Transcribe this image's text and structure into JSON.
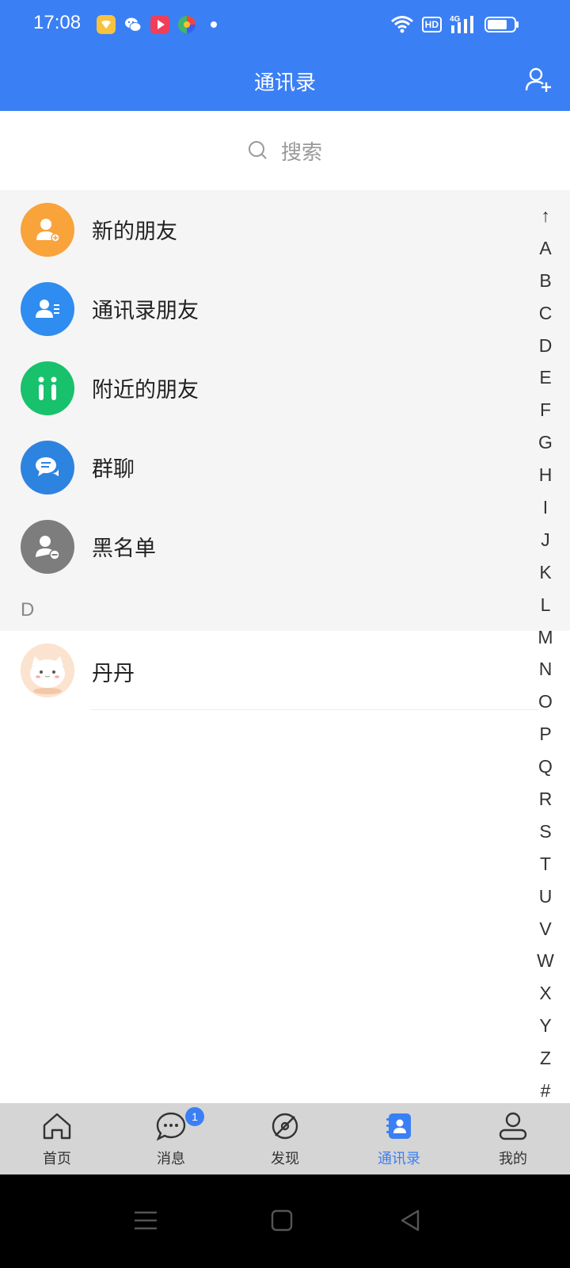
{
  "status_bar": {
    "time": "17:08",
    "notification_icons": [
      {
        "name": "notification-app-icon",
        "color": "#f7c23d"
      },
      {
        "name": "wechat-icon",
        "color": "#ffffff"
      },
      {
        "name": "video-app-icon",
        "color": "#f03e5a"
      },
      {
        "name": "browser-app-icon",
        "color": "#3fb76b"
      }
    ],
    "hd_label": "HD",
    "network_label": "4G"
  },
  "header": {
    "title": "通讯录",
    "add_friend_icon": "add-user-icon"
  },
  "search": {
    "placeholder": "搜索"
  },
  "functions": [
    {
      "label": "新的朋友",
      "icon": "new-friend-icon",
      "color": "#f9a33b"
    },
    {
      "label": "通讯录朋友",
      "icon": "contacts-friend-icon",
      "color": "#2f8cf0"
    },
    {
      "label": "附近的朋友",
      "icon": "nearby-friends-icon",
      "color": "#18c16b"
    },
    {
      "label": "群聊",
      "icon": "group-chat-icon",
      "color": "#2d84e0"
    },
    {
      "label": "黑名单",
      "icon": "blacklist-icon",
      "color": "#7d7d7d"
    }
  ],
  "sections": [
    {
      "header": "D",
      "contacts": [
        {
          "name": "丹丹",
          "avatar": "cat-avatar"
        }
      ]
    }
  ],
  "index_bar": [
    "↑",
    "A",
    "B",
    "C",
    "D",
    "E",
    "F",
    "G",
    "H",
    "I",
    "J",
    "K",
    "L",
    "M",
    "N",
    "O",
    "P",
    "Q",
    "R",
    "S",
    "T",
    "U",
    "V",
    "W",
    "X",
    "Y",
    "Z",
    "#"
  ],
  "tabs": [
    {
      "label": "首页",
      "icon": "home-icon",
      "active": false
    },
    {
      "label": "消息",
      "icon": "message-icon",
      "active": false,
      "badge": "1"
    },
    {
      "label": "发现",
      "icon": "discover-icon",
      "active": false
    },
    {
      "label": "通讯录",
      "icon": "contacts-icon",
      "active": true
    },
    {
      "label": "我的",
      "icon": "profile-icon",
      "active": false
    }
  ],
  "colors": {
    "accent": "#3b7ff5",
    "tab_bar_bg": "#d5d5d5",
    "function_bg": "#f5f5f5"
  }
}
